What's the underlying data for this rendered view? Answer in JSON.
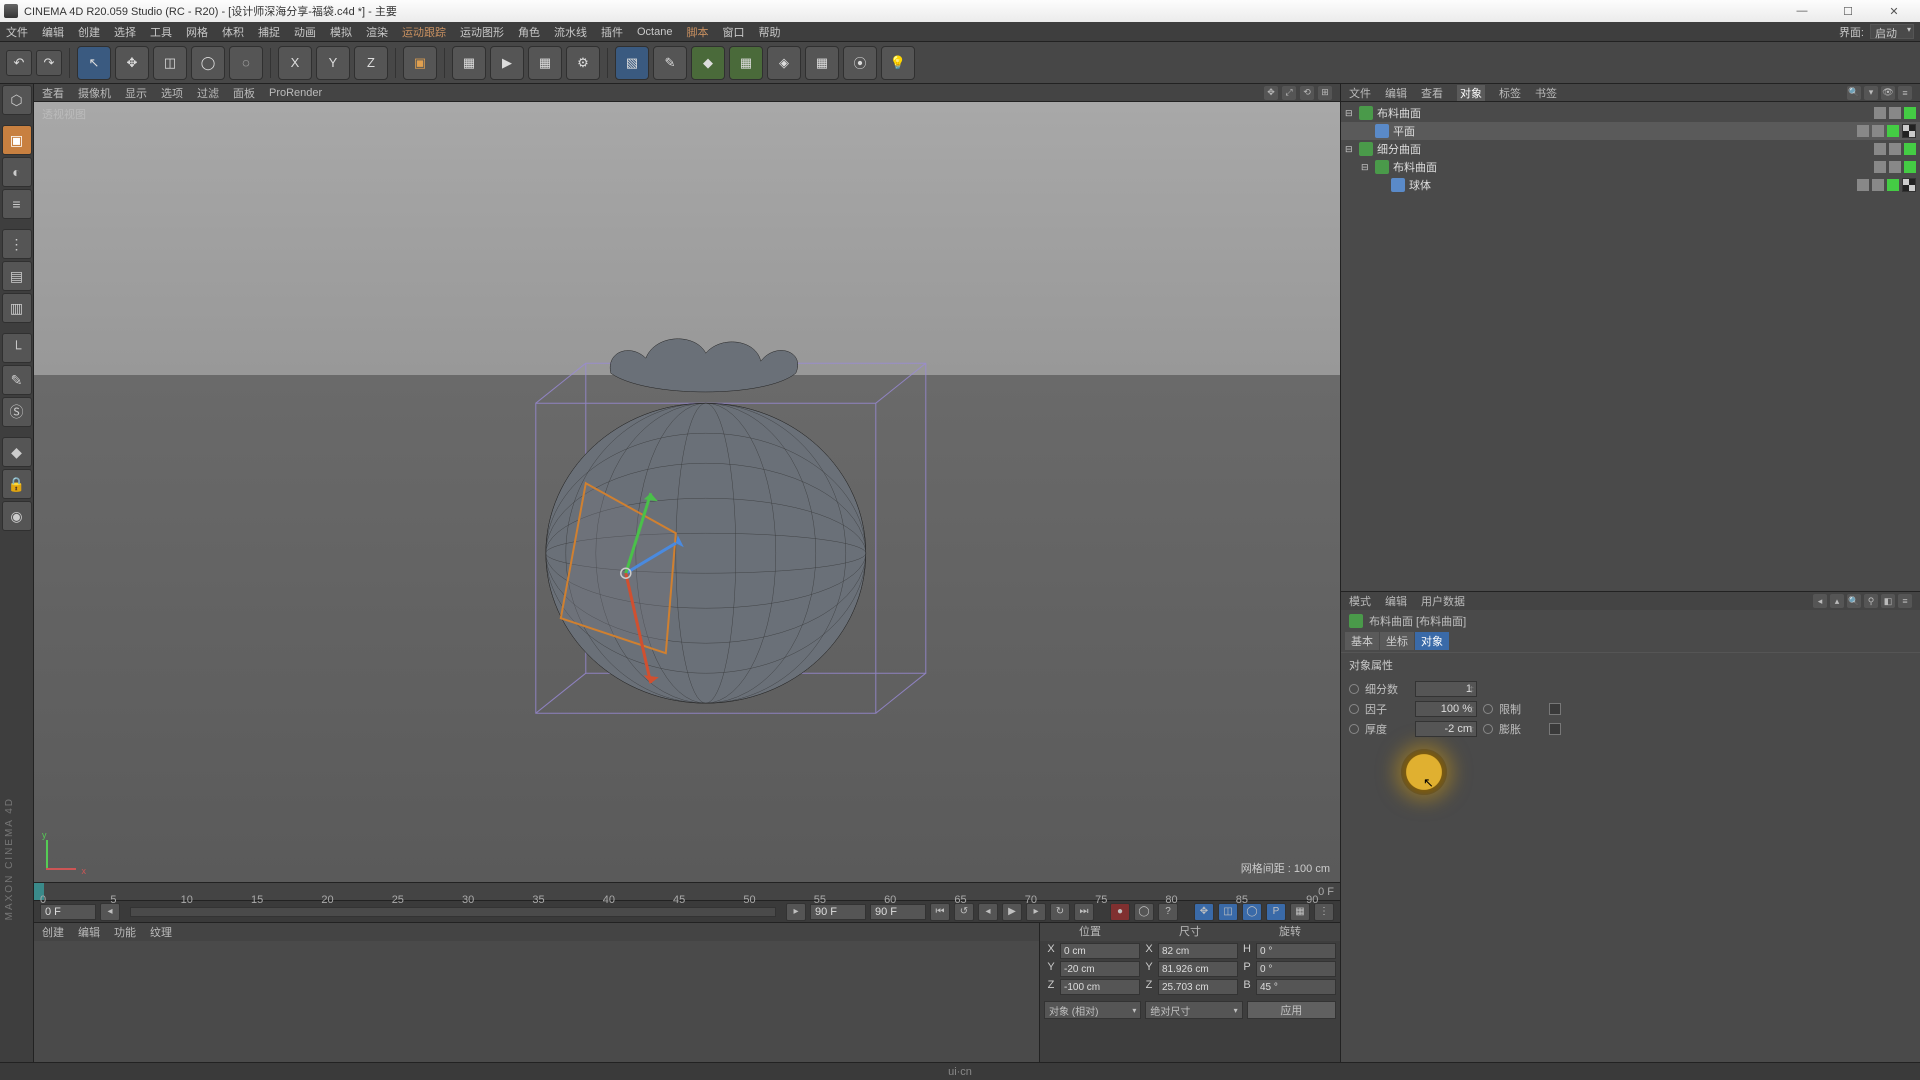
{
  "app": {
    "title": "CINEMA 4D R20.059 Studio (RC - R20) - [设计师深海分享-福袋.c4d *] - 主要",
    "side_brand": "MAXON CINEMA 4D"
  },
  "menubar": [
    "文件",
    "编辑",
    "创建",
    "选择",
    "工具",
    "网格",
    "体积",
    "捕捉",
    "动画",
    "模拟",
    "渲染",
    "运动跟踪",
    "运动图形",
    "角色",
    "流水线",
    "插件",
    "Octane",
    "脚本",
    "窗口",
    "帮助"
  ],
  "menubar_highlight": [
    "运动跟踪",
    "脚本"
  ],
  "corner": {
    "label": "界面:",
    "value": "启动"
  },
  "view_menu": [
    "查看",
    "摄像机",
    "显示",
    "选项",
    "过滤",
    "面板",
    "ProRender"
  ],
  "view_label": "透视视图",
  "grid_info": "网格间距 : 100 cm",
  "obj_panel_tabs": [
    "文件",
    "编辑",
    "查看",
    "对象",
    "标签",
    "书签"
  ],
  "obj_panel_active": "对象",
  "tree": [
    {
      "indent": 0,
      "exp": "⊟",
      "icon": "ic-green",
      "name": "布料曲面",
      "tags": [
        "a",
        "b",
        "c"
      ],
      "tex": false
    },
    {
      "indent": 1,
      "exp": "",
      "icon": "ic-blue",
      "name": "平面",
      "tags": [
        "a",
        "b",
        "c"
      ],
      "tex": true,
      "sel": true
    },
    {
      "indent": 0,
      "exp": "⊟",
      "icon": "ic-green",
      "name": "细分曲面",
      "tags": [
        "a",
        "b",
        "c"
      ],
      "tex": false
    },
    {
      "indent": 1,
      "exp": "⊟",
      "icon": "ic-green",
      "name": "布料曲面",
      "tags": [
        "a",
        "b",
        "c"
      ],
      "tex": false
    },
    {
      "indent": 2,
      "exp": "",
      "icon": "ic-blue",
      "name": "球体",
      "tags": [
        "a",
        "b",
        "c"
      ],
      "tex": true
    }
  ],
  "attr_menu": [
    "模式",
    "编辑",
    "用户数据"
  ],
  "attr_title": "布料曲面 [布料曲面]",
  "attr_tabs": [
    "基本",
    "坐标",
    "对象"
  ],
  "attr_tabs_active": "对象",
  "attr_section": "对象属性",
  "attr_rows": [
    {
      "label": "细分数",
      "value": "1",
      "label2": "",
      "check": false
    },
    {
      "label": "因子",
      "value": "100 %",
      "label2": "限制",
      "check": true
    },
    {
      "label": "厚度",
      "value": "-2 cm",
      "label2": "膨胀",
      "check": true
    }
  ],
  "timeline": {
    "start": 0,
    "end": 90,
    "step": 5,
    "current": 0,
    "right_label": "0 F"
  },
  "playback": {
    "left_field": "0 F",
    "mid_l": "90 F",
    "mid_r": "90 F"
  },
  "mat_menu": [
    "创建",
    "编辑",
    "功能",
    "纹理"
  ],
  "coord": {
    "headers": [
      "位置",
      "尺寸",
      "旋转"
    ],
    "rows": [
      {
        "a": "X",
        "av": "0 cm",
        "b": "X",
        "bv": "82 cm",
        "c": "H",
        "cv": "0 °"
      },
      {
        "a": "Y",
        "av": "-20 cm",
        "b": "Y",
        "bv": "81.926 cm",
        "c": "P",
        "cv": "0 °"
      },
      {
        "a": "Z",
        "av": "-100 cm",
        "b": "Z",
        "bv": "25.703 cm",
        "c": "B",
        "cv": "45 °"
      }
    ],
    "combo1": "对象 (相对)",
    "combo2": "绝对尺寸",
    "apply": "应用"
  },
  "statusbar": "ui·cn"
}
